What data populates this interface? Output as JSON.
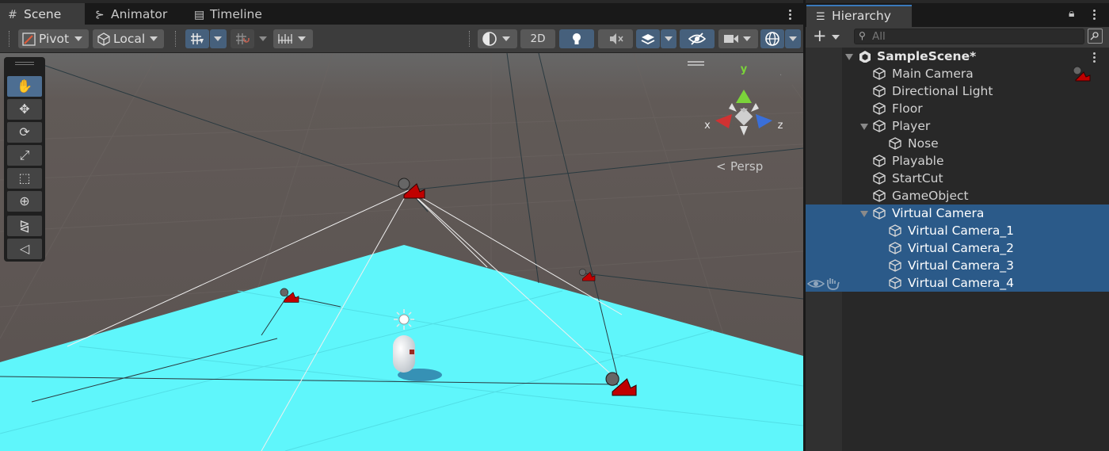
{
  "scene_tabs": [
    {
      "label": "Scene",
      "icon": "grid-icon"
    },
    {
      "label": "Animator",
      "icon": "animator-icon"
    },
    {
      "label": "Timeline",
      "icon": "film-icon"
    }
  ],
  "toolbar": {
    "pivot_label": "Pivot",
    "local_label": "Local",
    "mode_2d_label": "2D"
  },
  "gizmo": {
    "x_label": "x",
    "y_label": "y",
    "z_label": "z",
    "projection_label": "Persp"
  },
  "hierarchy": {
    "tab_label": "Hierarchy",
    "search_placeholder": "All",
    "scene_name": "SampleScene*",
    "items": [
      {
        "label": "Main Camera",
        "depth": 1,
        "expandable": false,
        "selected": false
      },
      {
        "label": "Directional Light",
        "depth": 1,
        "expandable": false,
        "selected": false
      },
      {
        "label": "Floor",
        "depth": 1,
        "expandable": false,
        "selected": false
      },
      {
        "label": "Player",
        "depth": 1,
        "expandable": true,
        "selected": false
      },
      {
        "label": "Nose",
        "depth": 2,
        "expandable": false,
        "selected": false
      },
      {
        "label": "Playable",
        "depth": 1,
        "expandable": false,
        "selected": false
      },
      {
        "label": "StartCut",
        "depth": 1,
        "expandable": false,
        "selected": false
      },
      {
        "label": "GameObject",
        "depth": 1,
        "expandable": false,
        "selected": false
      },
      {
        "label": "Virtual Camera",
        "depth": 1,
        "expandable": true,
        "selected": true
      },
      {
        "label": "Virtual Camera_1",
        "depth": 2,
        "expandable": false,
        "selected": true
      },
      {
        "label": "Virtual Camera_2",
        "depth": 2,
        "expandable": false,
        "selected": true
      },
      {
        "label": "Virtual Camera_3",
        "depth": 2,
        "expandable": false,
        "selected": true
      },
      {
        "label": "Virtual Camera_4",
        "depth": 2,
        "expandable": false,
        "selected": true
      }
    ]
  },
  "colors": {
    "selection": "#2b5a89",
    "floor": "#5ff6fb",
    "accent_tab": "#3a79bb",
    "camera_gizmo": "#c00000"
  }
}
